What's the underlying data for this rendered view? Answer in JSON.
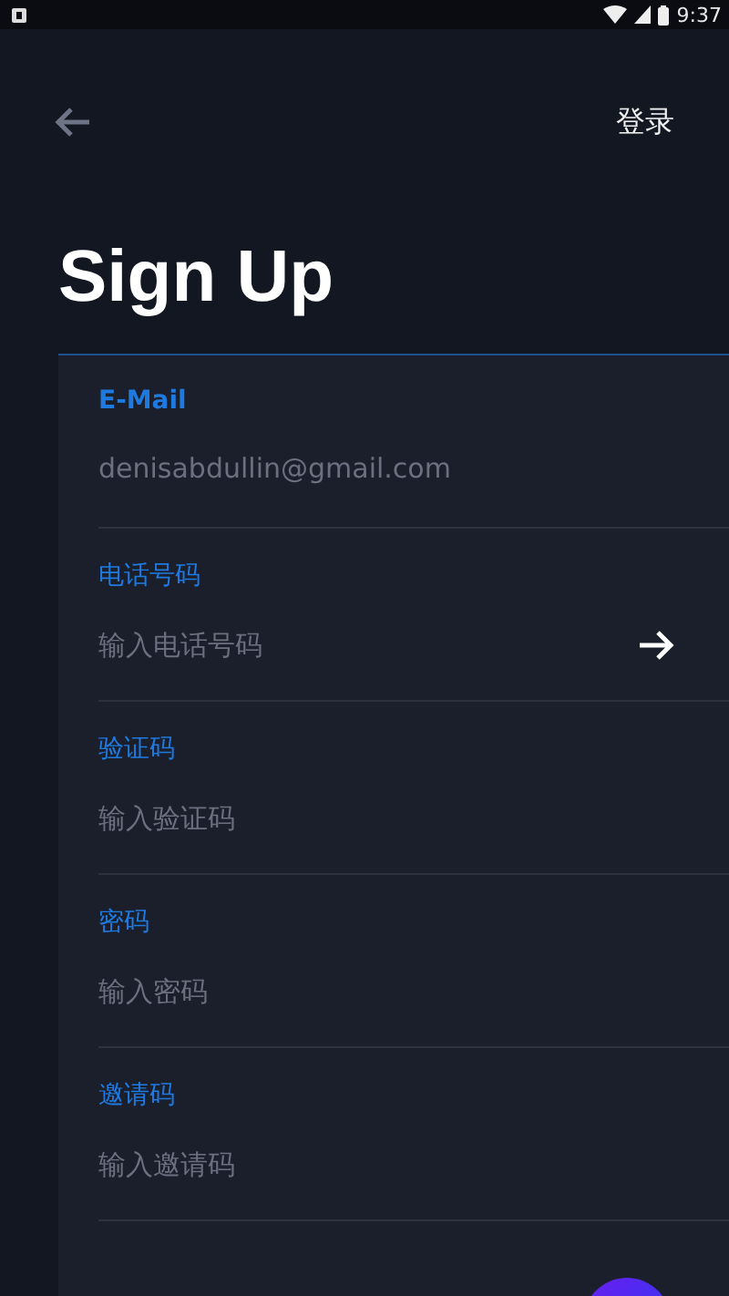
{
  "status_bar": {
    "time": "9:37"
  },
  "header": {
    "action": "登录"
  },
  "title": "Sign Up",
  "fields": [
    {
      "label": "E-Mail",
      "placeholder": "denisabdullin@gmail.com",
      "kind": "text"
    },
    {
      "label": "电话号码",
      "placeholder": "输入电话号码",
      "kind": "arrow"
    },
    {
      "label": "验证码",
      "placeholder": "输入验证码",
      "kind": "text"
    },
    {
      "label": "密码",
      "placeholder": "输入密码",
      "kind": "text"
    },
    {
      "label": "邀请码",
      "placeholder": "输入邀请码",
      "kind": "text"
    }
  ]
}
